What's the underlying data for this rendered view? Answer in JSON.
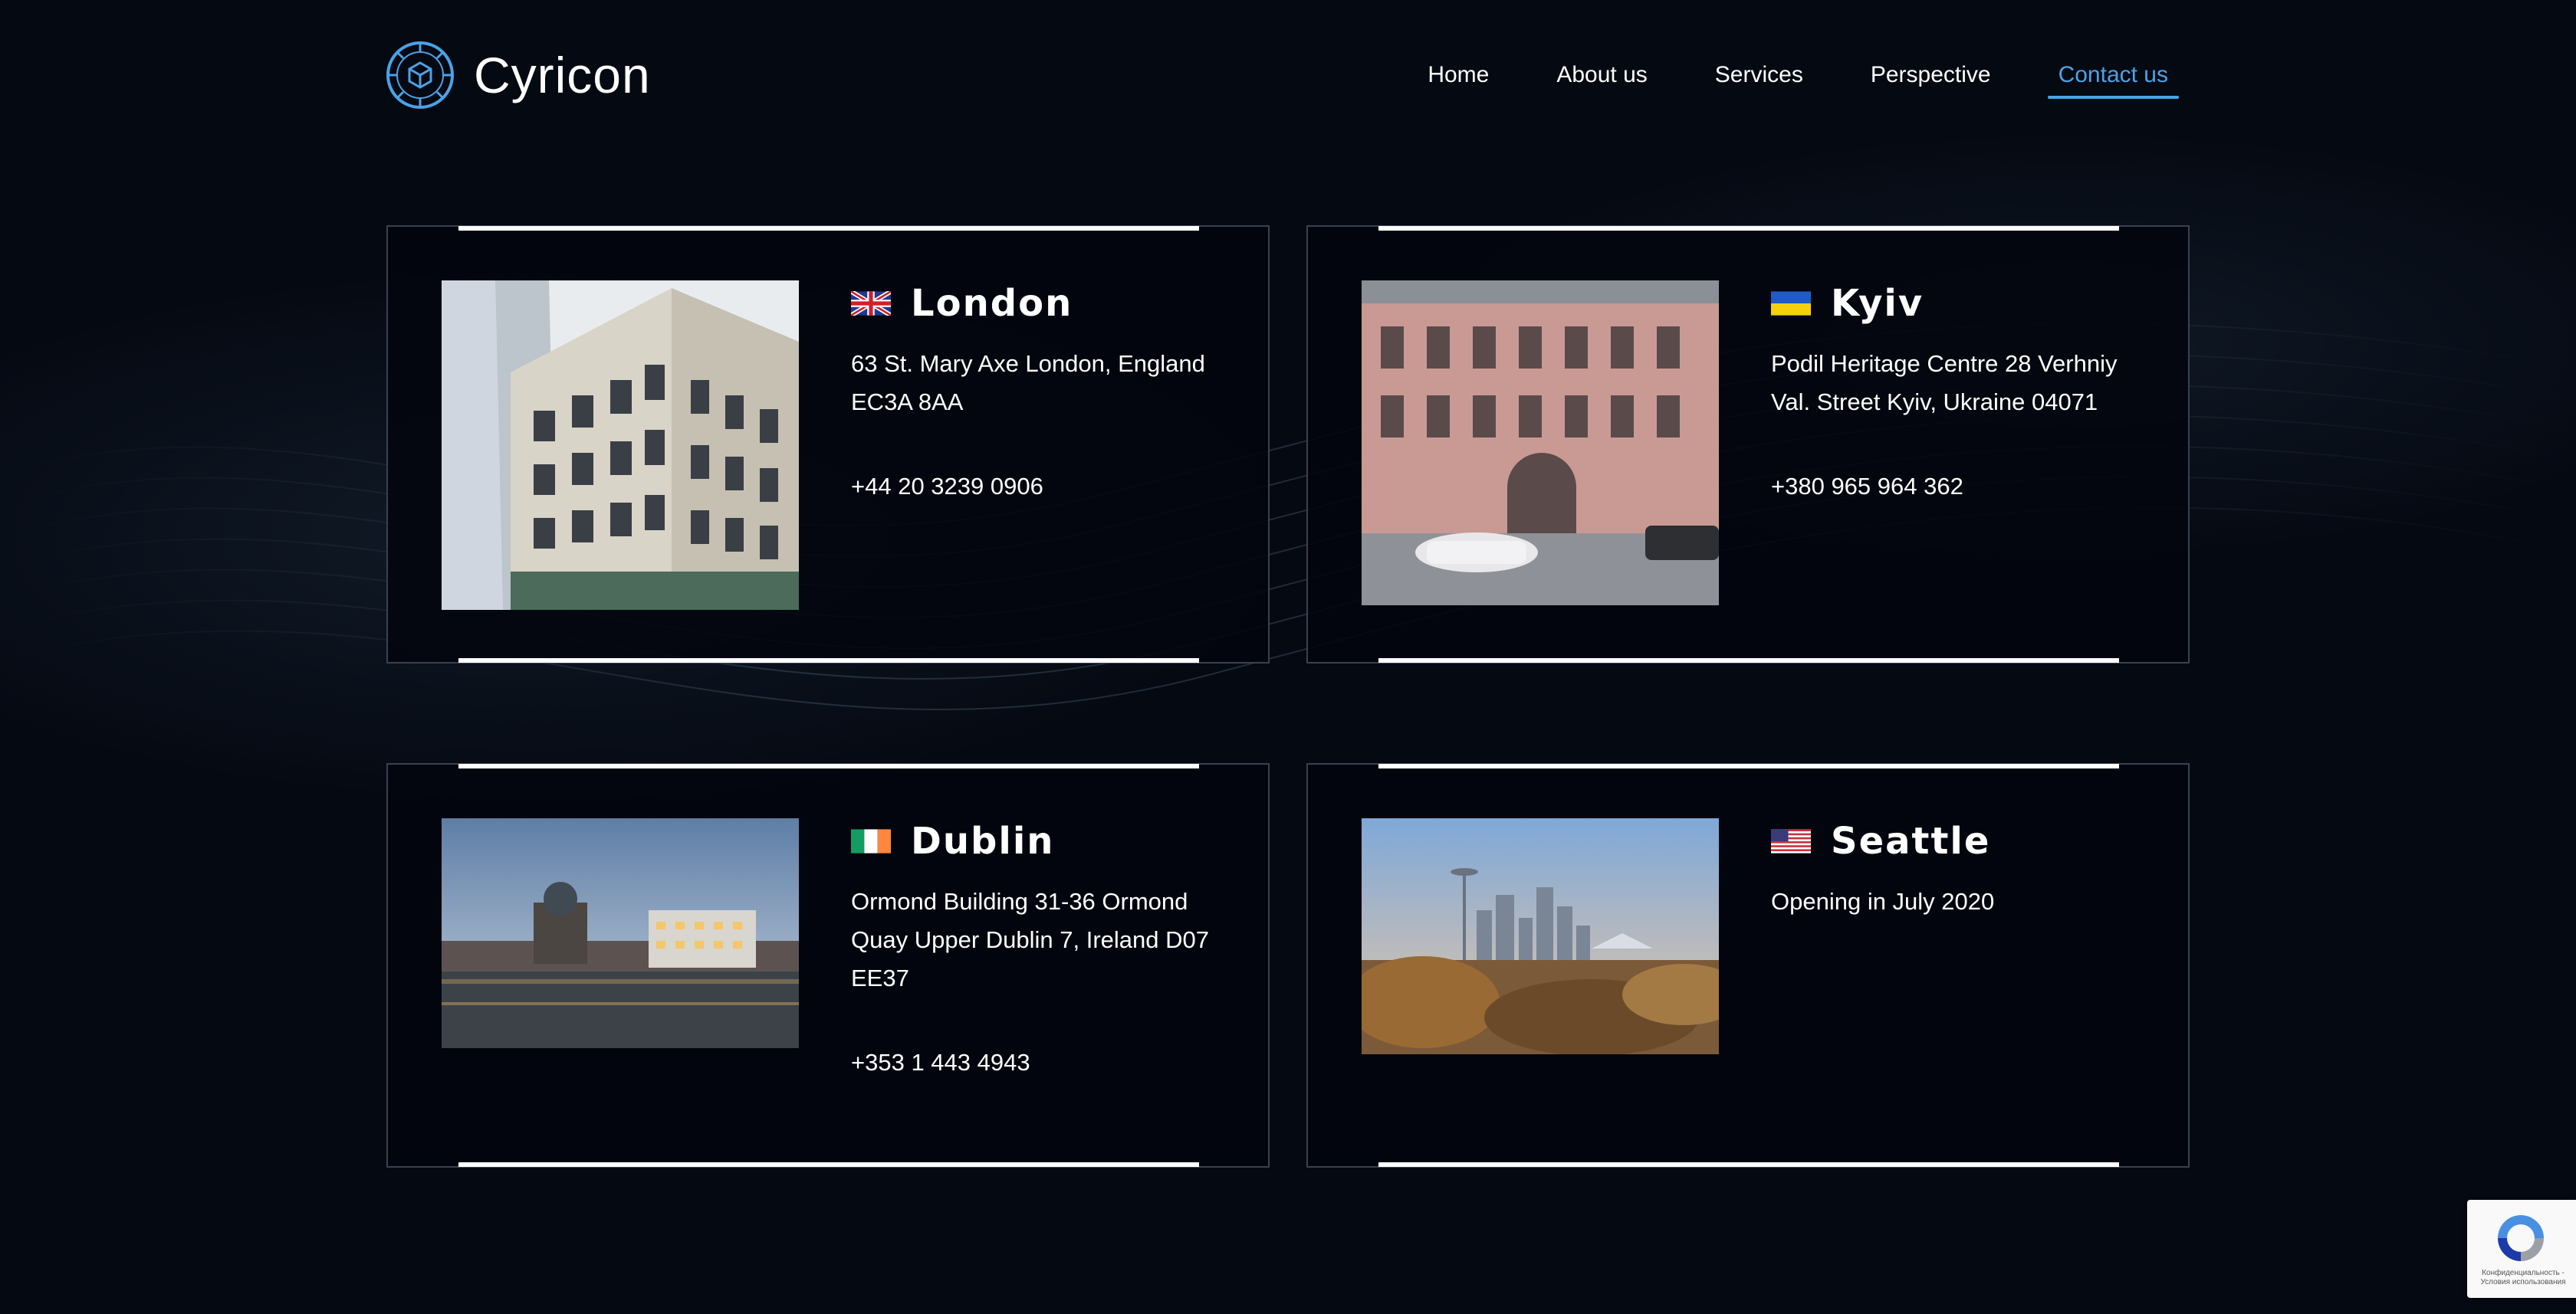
{
  "brand": {
    "name": "Cyricon",
    "logo": "cube-gear-logo-icon",
    "accent": "#4aa3e8"
  },
  "nav": {
    "items": [
      {
        "label": "Home"
      },
      {
        "label": "About us"
      },
      {
        "label": "Services"
      },
      {
        "label": "Perspective"
      },
      {
        "label": "Contact us",
        "active": true
      }
    ]
  },
  "offices": [
    {
      "city": "London",
      "flag": "uk-flag-icon",
      "photo": "london-office-building-photo",
      "address": "63 St. Mary Axe London, England EC3A 8AA",
      "phone": "+44 20 3239 0906"
    },
    {
      "city": "Kyiv",
      "flag": "ukraine-flag-icon",
      "photo": "kyiv-heritage-centre-photo",
      "address": "Podil Heritage Centre 28 Verhniy Val. Street Kyiv, Ukraine 04071",
      "phone": "+380 965 964 362"
    },
    {
      "city": "Dublin",
      "flag": "ireland-flag-icon",
      "photo": "dublin-quay-photo",
      "address": "Ormond Building 31-36 Ormond Quay Upper Dublin 7, Ireland D07 EE37",
      "phone": "+353 1 443 4943"
    },
    {
      "city": "Seattle",
      "flag": "usa-flag-icon",
      "photo": "seattle-skyline-photo",
      "address": "Opening in July 2020",
      "phone": ""
    }
  ],
  "recaptcha": {
    "text": "Конфиденциальность - Условия использования",
    "icon": "recaptcha-icon"
  }
}
